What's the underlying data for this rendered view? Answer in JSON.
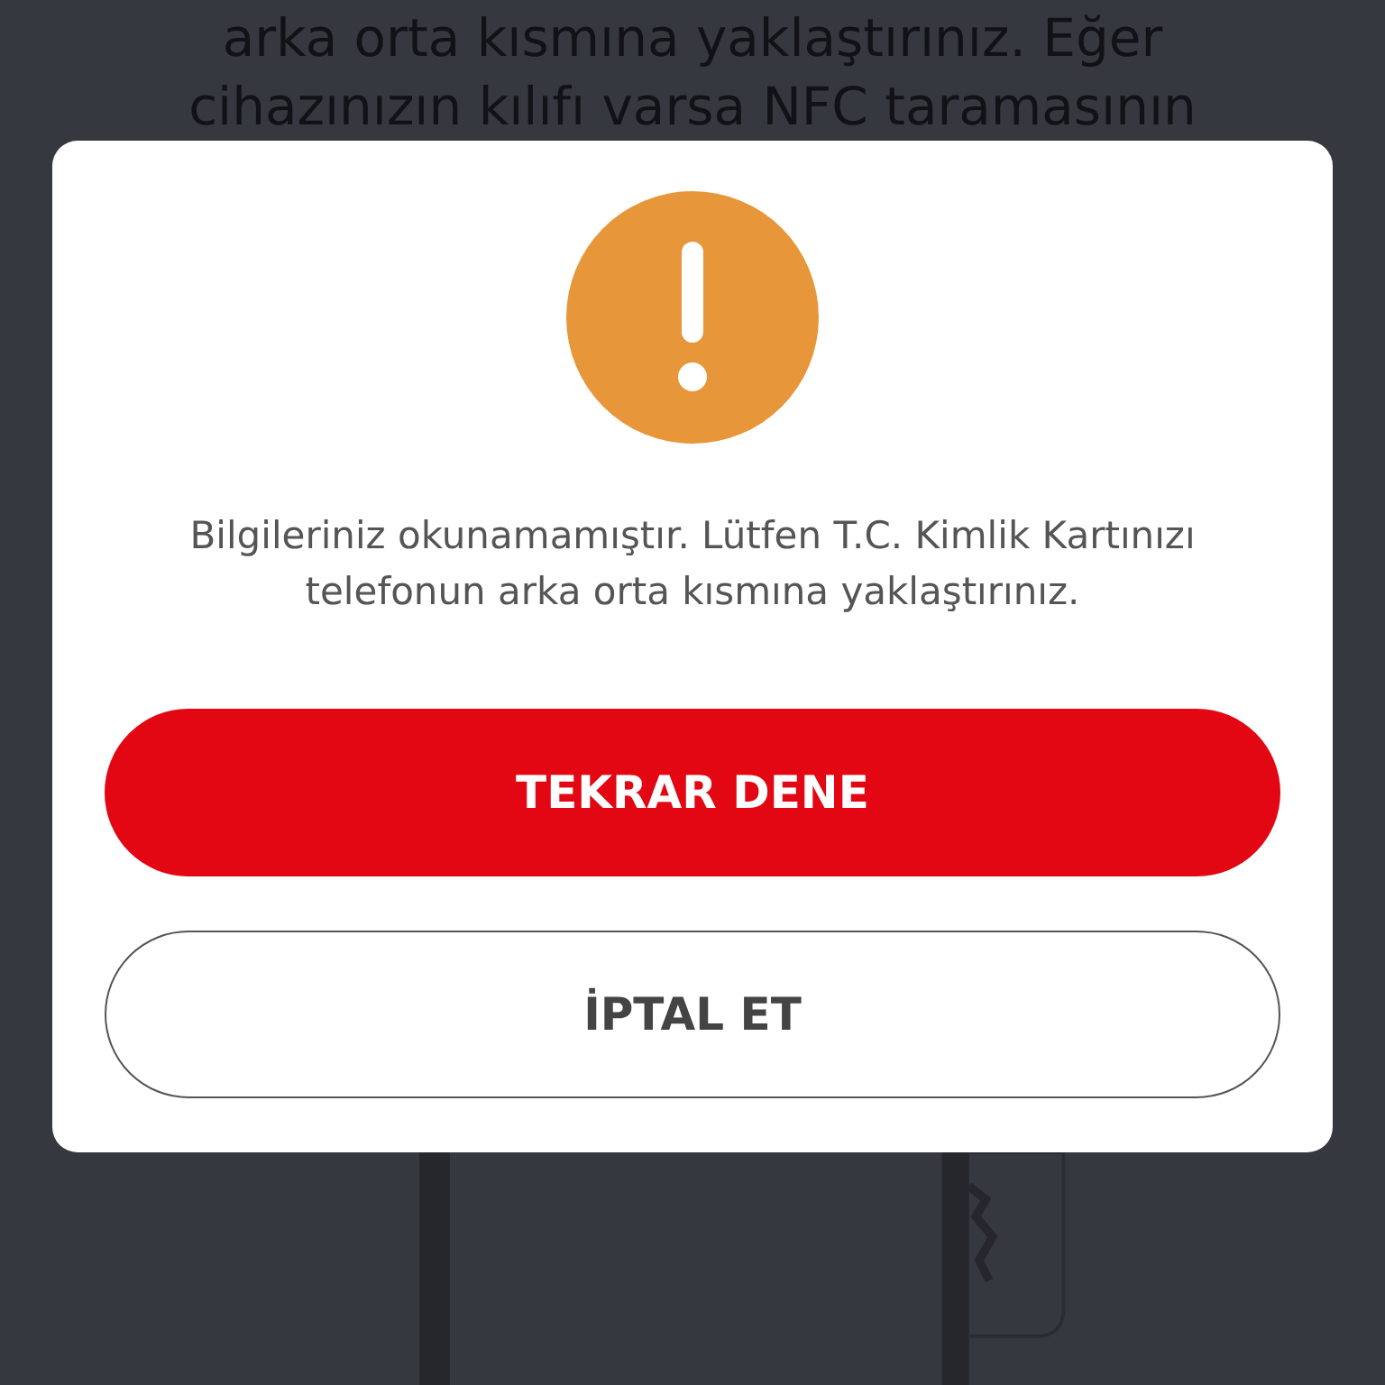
{
  "background_instructions": [
    "arka orta kısmına yaklaştırınız. Eğer",
    "cihazınızın kılıfı varsa NFC taramasının"
  ],
  "dialog": {
    "message": "Bilgileriniz okunamamıştır. Lütfen T.C. Kimlik Kartınızı telefonun arka orta kısmına yaklaştırınız.",
    "buttons": [
      {
        "label": "TEKRAR DENE",
        "kind": "primary"
      },
      {
        "label": "İPTAL ET",
        "kind": "outline"
      }
    ]
  }
}
